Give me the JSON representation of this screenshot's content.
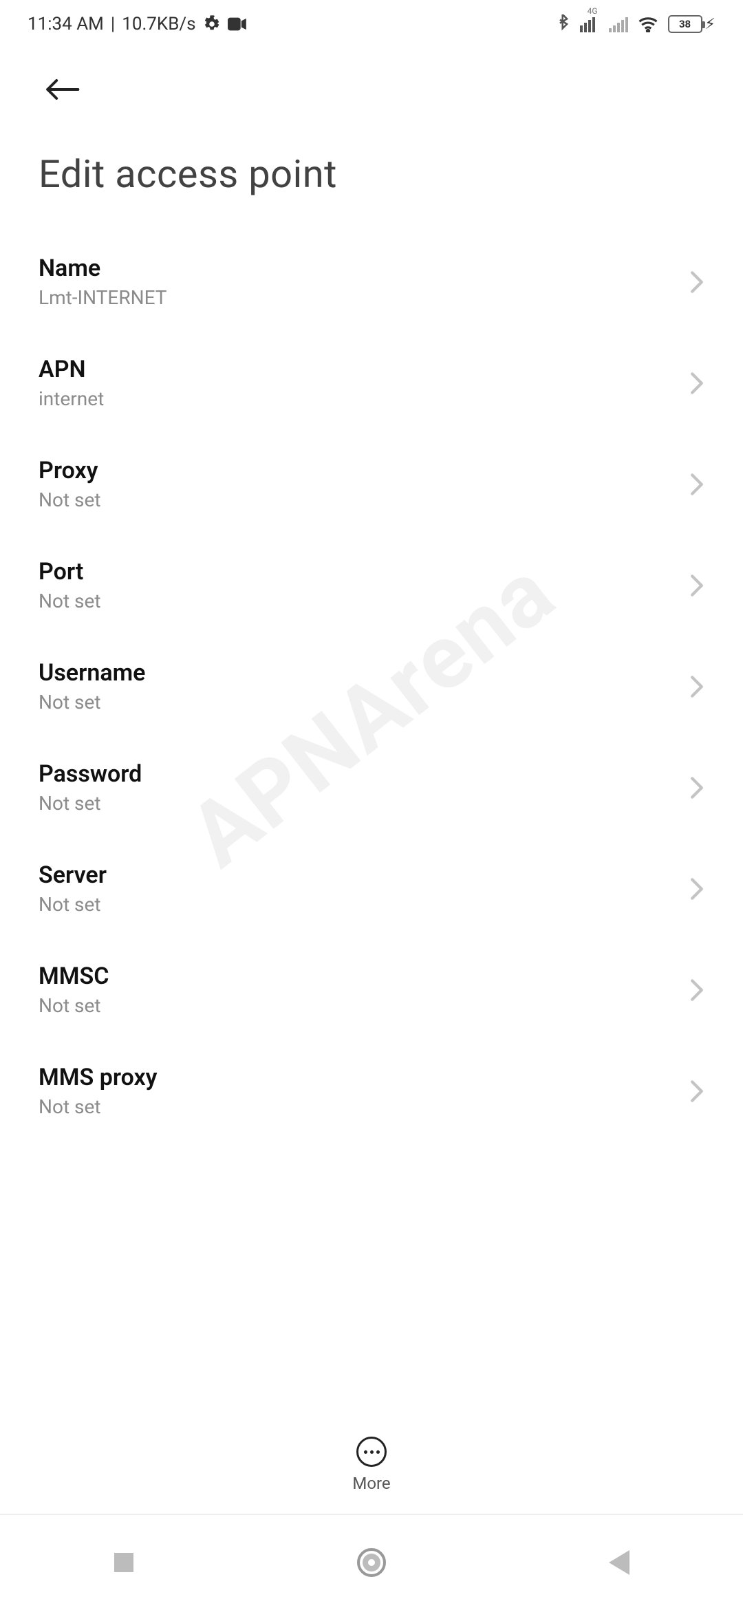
{
  "status": {
    "time": "11:34 AM",
    "speed": "10.7KB/s",
    "battery_pct": "38"
  },
  "header": {
    "title": "Edit access point"
  },
  "items": [
    {
      "label": "Name",
      "value": "Lmt-INTERNET",
      "name": "apn-name"
    },
    {
      "label": "APN",
      "value": "internet",
      "name": "apn-apn"
    },
    {
      "label": "Proxy",
      "value": "Not set",
      "name": "apn-proxy"
    },
    {
      "label": "Port",
      "value": "Not set",
      "name": "apn-port"
    },
    {
      "label": "Username",
      "value": "Not set",
      "name": "apn-username"
    },
    {
      "label": "Password",
      "value": "Not set",
      "name": "apn-password"
    },
    {
      "label": "Server",
      "value": "Not set",
      "name": "apn-server"
    },
    {
      "label": "MMSC",
      "value": "Not set",
      "name": "apn-mmsc"
    },
    {
      "label": "MMS proxy",
      "value": "Not set",
      "name": "apn-mms-proxy"
    }
  ],
  "bottom": {
    "more_label": "More"
  }
}
